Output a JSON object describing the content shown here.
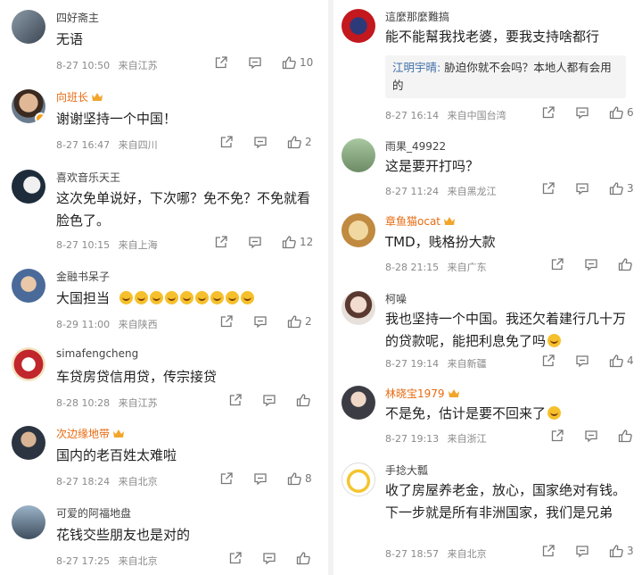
{
  "left_column": [
    {
      "user": "四好斋主",
      "vip": false,
      "content": "无语",
      "time": "8-27 10:50",
      "location": "来自江苏",
      "likes": "10"
    },
    {
      "user": "向班长",
      "vip": true,
      "content": "谢谢坚持一个中国！",
      "time": "8-27 16:47",
      "location": "来自四川",
      "likes": "2"
    },
    {
      "user": "喜欢音乐天王",
      "vip": false,
      "content": "这次免单说好，下次哪？免不免？不免就看脸色了。",
      "time": "8-27 10:15",
      "location": "来自上海",
      "likes": "12"
    },
    {
      "user": "金融书呆子",
      "vip": false,
      "content": "大国担当",
      "emoji_count": 9,
      "time": "8-29 11:00",
      "location": "来自陕西",
      "likes": "2"
    },
    {
      "user": "simafengcheng",
      "vip": false,
      "content": "车贷房贷信用贷，传宗接贷",
      "time": "8-28 10:28",
      "location": "来自江苏",
      "likes": ""
    },
    {
      "user": "次边缘地带",
      "vip": true,
      "content": "国内的老百姓太难啦",
      "time": "8-27 18:24",
      "location": "来自北京",
      "likes": "8"
    },
    {
      "user": "可爱的阿福地盘",
      "vip": false,
      "content": "花钱交些朋友也是对的",
      "time": "8-27 17:25",
      "location": "来自北京",
      "likes": ""
    }
  ],
  "right_column": [
    {
      "user": "這麼那麼難搞",
      "vip": false,
      "content": "能不能幫我找老婆，要我支持啥都行",
      "reply_user": "江明宇晴:",
      "reply_text": "胁迫你就不会吗？本地人都有会用的",
      "time": "8-27 16:14",
      "location": "来自中国台湾",
      "likes": "6"
    },
    {
      "user": "雨果_49922",
      "vip": false,
      "content": "这是要开打吗？",
      "time": "8-27 11:24",
      "location": "来自黑龙江",
      "likes": "3"
    },
    {
      "user": "章鱼猫ocat",
      "vip": true,
      "content": "TMD，贱格扮大款",
      "time": "8-28 21:15",
      "location": "来自广东",
      "likes": ""
    },
    {
      "user": "柯噪",
      "vip": false,
      "content": "我也坚持一个中国。我还欠着建行几十万的贷款呢，能把利息免了吗",
      "time": "8-27 19:14",
      "location": "来自新疆",
      "likes": "4"
    },
    {
      "user": "林晓宝1979",
      "vip": true,
      "content": "不是免，估计是要不回来了",
      "time": "8-27 19:13",
      "location": "来自浙江",
      "likes": ""
    },
    {
      "user": "手捻大瓢",
      "vip": false,
      "content": "收了房屋养老金，放心，国家绝对有钱。下一步就是所有非洲国家，我们是兄弟",
      "time": "8-27 18:57",
      "location": "来自北京",
      "likes": "3"
    }
  ],
  "colors": {
    "vip_name": "#e86a10",
    "meta": "#8a8a8a",
    "reply_name": "#3d6ea8"
  }
}
